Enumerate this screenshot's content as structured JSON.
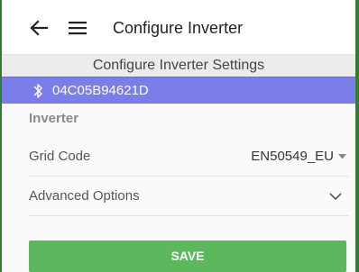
{
  "appbar": {
    "title": "Configure Inverter",
    "back_icon": "arrow-left-icon",
    "menu_icon": "hamburger-menu-icon"
  },
  "section": {
    "title": "Configure Inverter Settings"
  },
  "device": {
    "icon": "bluetooth-icon",
    "id": "04C05B94621D",
    "bar_color": "#7b7de9"
  },
  "form": {
    "group_label": "Inverter",
    "grid_code": {
      "label": "Grid Code",
      "value": "EN50549_EU"
    },
    "advanced": {
      "label": "Advanced Options"
    }
  },
  "actions": {
    "save_label": "SAVE",
    "save_color": "#5cb85c"
  }
}
